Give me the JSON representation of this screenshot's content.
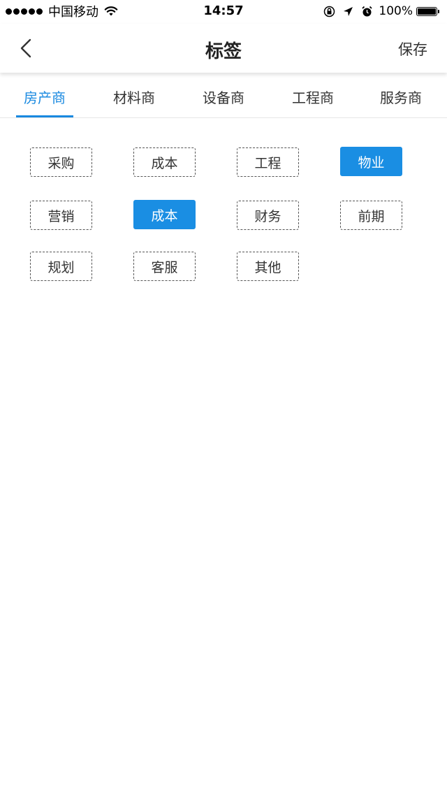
{
  "status_bar": {
    "carrier": "中国移动",
    "time": "14:57",
    "battery": "100%",
    "battery_level": 1.0
  },
  "nav": {
    "title": "标签",
    "save_label": "保存",
    "back_icon": "chevron-left-icon"
  },
  "tabs": [
    {
      "label": "房产商",
      "active": true
    },
    {
      "label": "材料商",
      "active": false
    },
    {
      "label": "设备商",
      "active": false
    },
    {
      "label": "工程商",
      "active": false
    },
    {
      "label": "服务商",
      "active": false
    }
  ],
  "tags": [
    {
      "label": "采购",
      "selected": false
    },
    {
      "label": "成本",
      "selected": false
    },
    {
      "label": "工程",
      "selected": false
    },
    {
      "label": "物业",
      "selected": true
    },
    {
      "label": "营销",
      "selected": false
    },
    {
      "label": "成本",
      "selected": true
    },
    {
      "label": "财务",
      "selected": false
    },
    {
      "label": "前期",
      "selected": false
    },
    {
      "label": "规划",
      "selected": false
    },
    {
      "label": "客服",
      "selected": false
    },
    {
      "label": "其他",
      "selected": false
    }
  ],
  "colors": {
    "accent": "#1989e0",
    "selected_tag_bg": "#1a8ee3"
  }
}
